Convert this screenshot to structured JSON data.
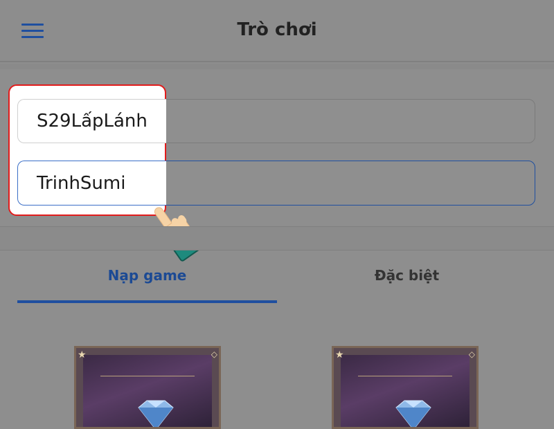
{
  "header": {
    "title": "Trò chơi",
    "menu_icon": "hamburger-menu-icon"
  },
  "form": {
    "server_value": "S29LấpLánh",
    "character_value": "TrinhSumi"
  },
  "tabs": [
    {
      "label": "Nạp game",
      "active": true
    },
    {
      "label": "Đặc biệt",
      "active": false
    }
  ],
  "annotation": {
    "highlight_color": "#e21b1b",
    "pointer_icon": "pointing-hand-icon"
  },
  "colors": {
    "accent": "#1f4f9f",
    "overlay": "#8e8e8e"
  },
  "cards": [
    {
      "icon": "diamond-icon"
    },
    {
      "icon": "diamond-icon"
    }
  ]
}
